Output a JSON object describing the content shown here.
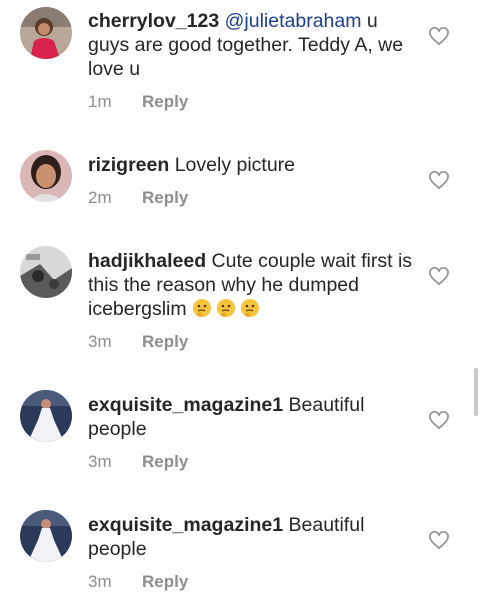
{
  "comments": [
    {
      "username": "cherrylov_123",
      "mention": "@julietabraham",
      "text": " u guys are good together. Teddy A, we love u",
      "time": "1m",
      "reply_label": "Reply",
      "avatar_icon": "avatar-woman-red-dress"
    },
    {
      "username": "rizigreen",
      "mention": "",
      "text": " Lovely picture",
      "time": "2m",
      "reply_label": "Reply",
      "avatar_icon": "avatar-woman-portrait"
    },
    {
      "username": "hadjikhaleed",
      "mention": "",
      "text": " Cute couple wait first is this the reason why he dumped icebergslim",
      "emojis": [
        "thinking-face",
        "thinking-face",
        "thinking-face"
      ],
      "time": "3m",
      "reply_label": "Reply",
      "avatar_icon": "avatar-black-white-photo"
    },
    {
      "username": "exquisite_magazine1",
      "mention": "",
      "text": " Beautiful people",
      "time": "3m",
      "reply_label": "Reply",
      "avatar_icon": "avatar-bride-gown"
    },
    {
      "username": "exquisite_magazine1",
      "mention": "",
      "text": " Beautiful people",
      "time": "3m",
      "reply_label": "Reply",
      "avatar_icon": "avatar-bride-gown"
    }
  ],
  "colors": {
    "text": "#262626",
    "mention": "#1a3f8c",
    "muted": "#8e8e8e",
    "background": "#ffffff"
  }
}
